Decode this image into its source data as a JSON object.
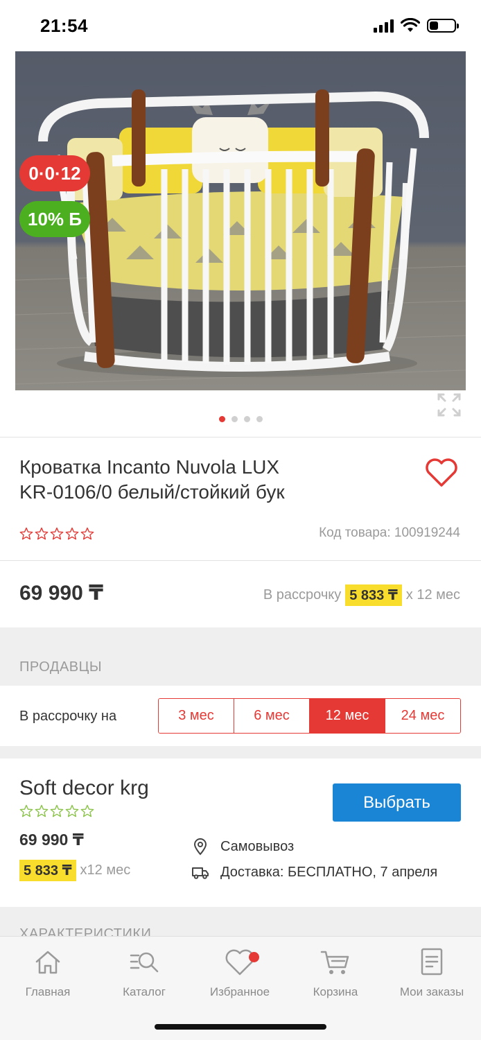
{
  "status_bar": {
    "time": "21:54",
    "battery_percent": 35
  },
  "gallery": {
    "badge_installment": "0·0·12",
    "badge_bonus": "10% Б",
    "slide_count": 4,
    "active_slide": 1
  },
  "product": {
    "title_line1": "Кроватка Incanto Nuvola LUX",
    "title_line2": "KR-0106/0 белый/стойкий бук",
    "rating": 0,
    "code": "Код товара: 100919244",
    "price": "69 990 ₸",
    "installment_prefix": "В рассрочку",
    "installment_amount": "5 833 ₸",
    "installment_suffix": "х 12 мес"
  },
  "sellers": {
    "heading": "ПРОДАВЦЫ",
    "installment_label": "В рассрочку на",
    "terms": [
      "3 мес",
      "6 мес",
      "12 мес",
      "24 мес"
    ],
    "selected_term": "12 мес"
  },
  "seller_card": {
    "name": "Soft decor krg",
    "rating": 0,
    "select_label": "Выбрать",
    "price": "69 990 ₸",
    "installment_amount": "5 833 ₸",
    "installment_suffix": "x12 мес",
    "pickup": "Самовывоз",
    "delivery": "Доставка: БЕСПЛАТНО, 7 апреля"
  },
  "characteristics_heading": "ХАРАКТЕРИСТИКИ",
  "bottom_nav": [
    {
      "label": "Главная",
      "icon": "home-icon"
    },
    {
      "label": "Каталог",
      "icon": "catalog-search-icon"
    },
    {
      "label": "Избранное",
      "icon": "heart-icon"
    },
    {
      "label": "Корзина",
      "icon": "cart-icon"
    },
    {
      "label": "Мои заказы",
      "icon": "orders-icon"
    }
  ],
  "colors": {
    "accent_red": "#e53935",
    "accent_blue": "#1b85d5",
    "highlight_yellow": "#f8dd2c",
    "bonus_green": "#4caf1f",
    "seller_star_green": "#8bc34a"
  }
}
